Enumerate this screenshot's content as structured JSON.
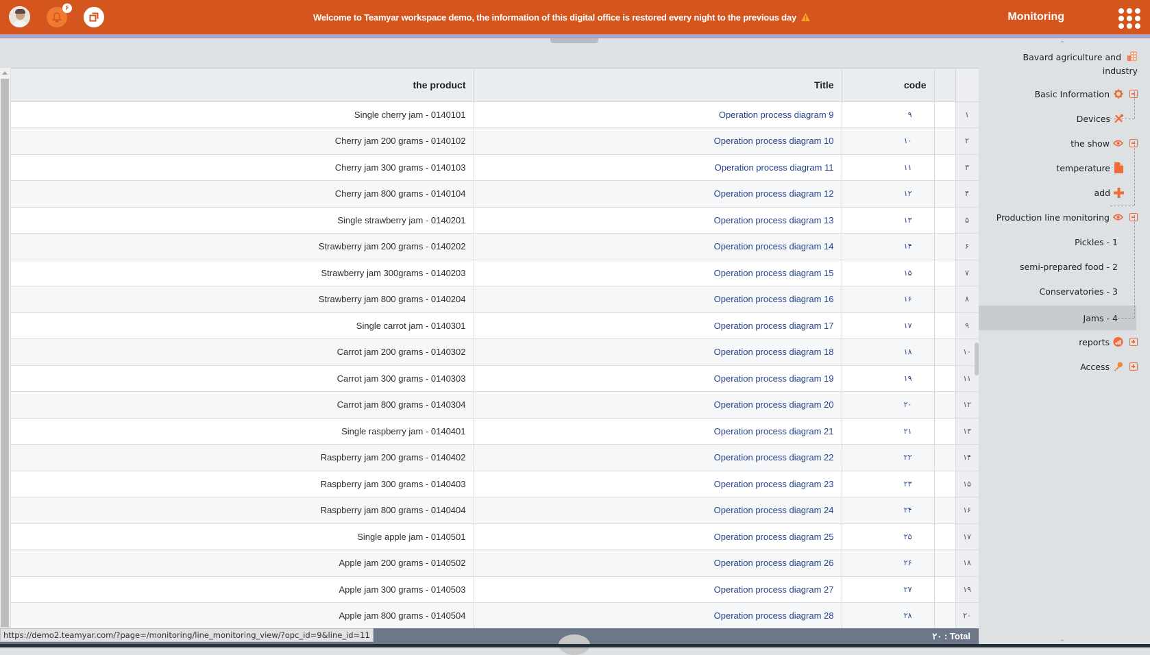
{
  "header": {
    "notification_count": "۶",
    "welcome_message": "Welcome to Teamyar workspace demo, the information of this digital office is restored every night to the previous day",
    "app_title": "Monitoring",
    "colors": {
      "topbar": "#d4561e",
      "accent_strip": "#a9a4c9",
      "icon_accent": "#ef6b3a",
      "link": "#27448a"
    }
  },
  "table": {
    "columns": {
      "product": "the product",
      "title": "Title",
      "code": "code",
      "blank": "",
      "rownum": ""
    },
    "rows": [
      {
        "n": "۱",
        "code": "۹",
        "title": "Operation process diagram 9",
        "product": "Single cherry jam - 0140101"
      },
      {
        "n": "۲",
        "code": "۱۰",
        "title": "Operation process diagram 10",
        "product": "Cherry jam 200 grams - 0140102"
      },
      {
        "n": "۳",
        "code": "۱۱",
        "title": "Operation process diagram 11",
        "product": "Cherry jam 300 grams - 0140103"
      },
      {
        "n": "۴",
        "code": "۱۲",
        "title": "Operation process diagram 12",
        "product": "Cherry jam 800 grams - 0140104"
      },
      {
        "n": "۵",
        "code": "۱۳",
        "title": "Operation process diagram 13",
        "product": "Single strawberry jam - 0140201"
      },
      {
        "n": "۶",
        "code": "۱۴",
        "title": "Operation process diagram 14",
        "product": "Strawberry jam 200 grams - 0140202"
      },
      {
        "n": "۷",
        "code": "۱۵",
        "title": "Operation process diagram 15",
        "product": "Strawberry jam 300grams - 0140203"
      },
      {
        "n": "۸",
        "code": "۱۶",
        "title": "Operation process diagram 16",
        "product": "Strawberry jam 800 grams - 0140204"
      },
      {
        "n": "۹",
        "code": "۱۷",
        "title": "Operation process diagram 17",
        "product": "Single carrot jam - 0140301"
      },
      {
        "n": "۱۰",
        "code": "۱۸",
        "title": "Operation process diagram 18",
        "product": "Carrot jam 200 grams - 0140302"
      },
      {
        "n": "۱۱",
        "code": "۱۹",
        "title": "Operation process diagram 19",
        "product": "Carrot jam 300 grams - 0140303"
      },
      {
        "n": "۱۲",
        "code": "۲۰",
        "title": "Operation process diagram 20",
        "product": "Carrot jam 800 grams - 0140304"
      },
      {
        "n": "۱۳",
        "code": "۲۱",
        "title": "Operation process diagram 21",
        "product": "Single raspberry jam - 0140401"
      },
      {
        "n": "۱۴",
        "code": "۲۲",
        "title": "Operation process diagram 22",
        "product": "Raspberry jam 200 grams - 0140402"
      },
      {
        "n": "۱۵",
        "code": "۲۳",
        "title": "Operation process diagram 23",
        "product": "Raspberry jam 300 grams - 0140403"
      },
      {
        "n": "۱۶",
        "code": "۲۴",
        "title": "Operation process diagram 24",
        "product": "Raspberry jam 800 grams - 0140404"
      },
      {
        "n": "۱۷",
        "code": "۲۵",
        "title": "Operation process diagram 25",
        "product": "Single apple jam - 0140501"
      },
      {
        "n": "۱۸",
        "code": "۲۶",
        "title": "Operation process diagram 26",
        "product": "Apple jam 200 grams - 0140502"
      },
      {
        "n": "۱۹",
        "code": "۲۷",
        "title": "Operation process diagram 27",
        "product": "Apple jam 300 grams - 0140503"
      },
      {
        "n": "۲۰",
        "code": "۲۸",
        "title": "Operation process diagram 28",
        "product": "Apple jam 800 grams - 0140504"
      }
    ],
    "total_label": "۲۰ : Total"
  },
  "status_url": "https://demo2.teamyar.com/?page=/monitoring/line_monitoring_view/?opc_id=9&line_id=11",
  "sidebar": {
    "company": {
      "line1": "Bavard  agriculture and",
      "line2": "industry",
      "icon": "building-icon"
    },
    "items": [
      {
        "label": "Basic Information",
        "icon": "gear-icon",
        "toggle": "collapse"
      },
      {
        "label": "Devices",
        "icon": "tools-icon"
      },
      {
        "label": "the show",
        "icon": "eye-icon",
        "toggle": "collapse"
      },
      {
        "label": "temperature",
        "icon": "file-icon"
      },
      {
        "label": "add",
        "icon": "plus-icon"
      },
      {
        "label": "Production line monitoring",
        "icon": "eye-icon",
        "toggle": "collapse"
      },
      {
        "label": "Pickles  - 1"
      },
      {
        "label": "semi-prepared food - 2"
      },
      {
        "label": "Conservatories - 3"
      },
      {
        "label": "Jams - 4",
        "active": true
      },
      {
        "label": "reports",
        "icon": "chart-icon",
        "toggle": "expand"
      },
      {
        "label": "Access",
        "icon": "key-icon",
        "toggle": "expand"
      }
    ]
  }
}
